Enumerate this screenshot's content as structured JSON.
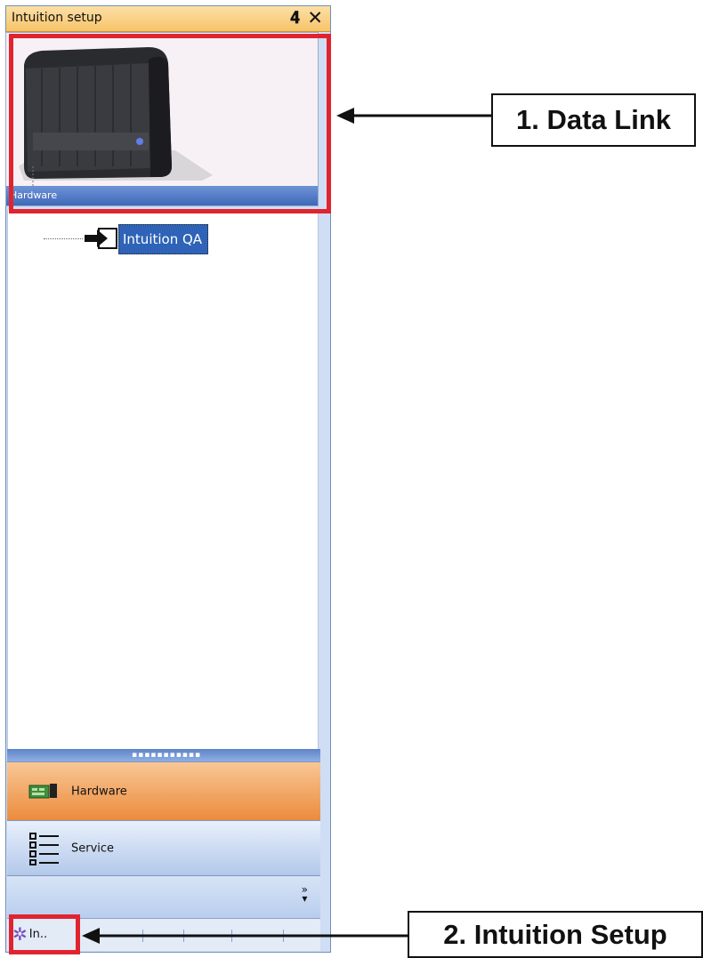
{
  "panel": {
    "title": "Intuition setup",
    "pin_icon": "pin-icon",
    "close_icon": "close-icon",
    "preview": {
      "caption": "Hardware",
      "image": "device-image"
    },
    "tree": {
      "node_label": "Intuition QA",
      "node_icon": "data-link-icon"
    },
    "nav": {
      "hardware_label": "Hardware",
      "service_label": "Service",
      "overflow_icon": "chevron-double-down-icon"
    },
    "bottom_tab": {
      "label": "In..",
      "icon": "gear-icon"
    }
  },
  "callouts": {
    "data_link": "1. Data Link",
    "intuition_setup": "2. Intuition Setup"
  },
  "colors": {
    "highlight": "#e0242f",
    "title_bar": "#f7c46a",
    "selected_node": "#2e63b7",
    "nav_active": "#ec8b3c"
  }
}
